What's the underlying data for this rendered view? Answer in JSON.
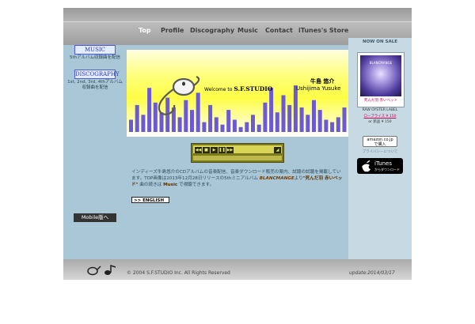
{
  "nav": {
    "items": [
      {
        "label": "Top",
        "active": true
      },
      {
        "label": "Profile",
        "active": false
      },
      {
        "label": "Discography",
        "active": false
      },
      {
        "label": "Music",
        "active": false
      },
      {
        "label": "Contact",
        "active": false
      },
      {
        "label": "iTunes's Store",
        "active": false
      }
    ]
  },
  "left": {
    "music_button": "MUSIC",
    "music_note": "5thアルバム収録曲を配信",
    "disco_button": "DISCOGRAPHY",
    "disco_note": "1st, 2nd, 3rd, 4thアルバム収録曲を配信",
    "mobile_button": "Mobile版へ"
  },
  "banner": {
    "welcome_prefix": "Welcome to",
    "welcome_name": "S.F.STUDIO",
    "name_jp": "牛島 悠介",
    "name_en": "Ushijima Yusuke",
    "levels": [
      0.25,
      0.55,
      0.35,
      0.9,
      0.6,
      0.4,
      0.7,
      0.5,
      0.3,
      0.65,
      0.45,
      0.8,
      0.2,
      0.55,
      0.3,
      0.15,
      0.45,
      0.25,
      0.1,
      0.2,
      0.35,
      0.15,
      0.6,
      0.9,
      0.4,
      0.75,
      0.55,
      0.95,
      0.5,
      0.35,
      0.65,
      0.45,
      0.25,
      0.2,
      0.3,
      0.5
    ]
  },
  "body": {
    "text_1": "インディーズ牛島悠介のCDアルバムの音楽配信、音楽ダウンロード販売の案内、試聴の試聴を掲載しています。TOP画像は2013年12月28日リリースの5thミニアルバム",
    "highlight_1": "BLANCMANGE",
    "text_2": "より",
    "highlight_2": "\"死んだ羽 赤いベッド\"",
    "text_3": "曲の続きは",
    "highlight_3": "Music",
    "text_4": "で視聴できます。",
    "english_button": ">> ENGLISH"
  },
  "right": {
    "now_on_sale": "NOW ON SALE",
    "album_art_text": "BLANCMANGE",
    "album_caption": "死んだ羽 赤いベッド",
    "label": "RAW OYSTER LABEL",
    "price_link": "ローブライス ¥ 150",
    "price_new": "or 新品 ¥ 150",
    "amazon_line1": "amazon.co.jp",
    "amazon_line2": "で購入",
    "privacy_note": "プライバシーについて",
    "itunes_title": "iTunes",
    "itunes_sub": "からダウンロード"
  },
  "footer": {
    "copyright": "© 2004 S.F.STUDIO Inc. All Rights Reserved",
    "update": "update:2014/03/17"
  },
  "colors": {
    "frame_bg": "#a9c7d6",
    "nav_active": "#ffffff",
    "bar_color": "#6c5ad4",
    "price_link": "#cc0055"
  }
}
